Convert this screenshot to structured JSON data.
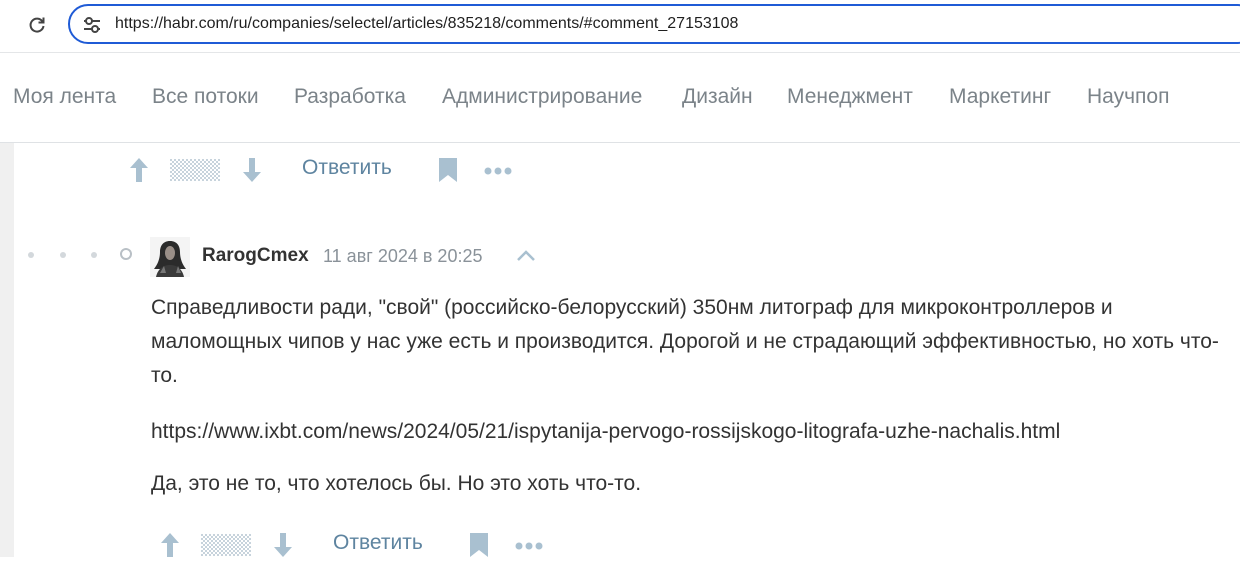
{
  "browser": {
    "url": "https://habr.com/ru/companies/selectel/articles/835218/comments/#comment_27153108"
  },
  "nav": {
    "items": [
      "Моя лента",
      "Все потоки",
      "Разработка",
      "Администрирование",
      "Дизайн",
      "Менеджмент",
      "Маркетинг",
      "Научпоп"
    ]
  },
  "comments": [
    {
      "actions": {
        "reply_label": "Ответить"
      }
    },
    {
      "author": "RarogCmex",
      "timestamp": "11 авг 2024 в 20:25",
      "paragraphs": [
        "Справедливости ради, \"свой\" (российско-белорусский) 350нм литограф для микроконтроллеров и маломощных чипов у нас уже есть и производится. Дорогой и не страдающий эффективностью, но хоть что-то.",
        "https://www.ixbt.com/news/2024/05/21/ispytanija-pervogo-rossijskogo-litografa-uzhe-nachalis.html",
        "Да, это не то, что хотелось бы. Но это хоть что-то."
      ],
      "actions": {
        "reply_label": "Ответить"
      }
    }
  ],
  "colors": {
    "accent_blue": "#1f5bd6",
    "nav_text": "#7b8389",
    "reply_link": "#5e84a0",
    "icon_gray": "#a9c0d0",
    "page_bg": "#f0f0f0"
  }
}
